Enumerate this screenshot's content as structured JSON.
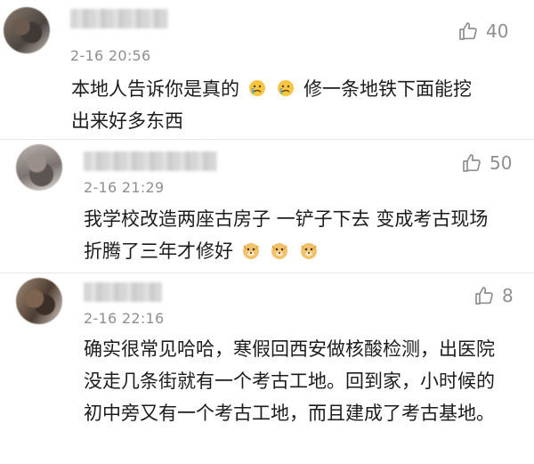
{
  "comments": [
    {
      "timestamp": "2-16 20:56",
      "likes": "40",
      "text_before_emoji": "本地人告诉你是真的",
      "emoji": [
        "crying-face",
        "crying-face"
      ],
      "text_after_emoji": "修一条地铁下面能挖出来好多东西"
    },
    {
      "timestamp": "2-16 21:29",
      "likes": "50",
      "text_before_emoji": "我学校改造两座古房子 一铲子下去 变成考古现场 折腾了三年才修好",
      "emoji": [
        "doge",
        "doge",
        "doge"
      ],
      "text_after_emoji": ""
    },
    {
      "timestamp": "2-16 22:16",
      "likes": "8",
      "text_before_emoji": "确实很常见哈哈，寒假回西安做核酸检测，出医院没走几条街就有一个考古工地。回到家，小时候的初中旁又有一个考古工地，而且建成了考古基地。",
      "emoji": [],
      "text_after_emoji": ""
    }
  ],
  "colors": {
    "meta": "#8f8f8f",
    "text": "#1c1c1c",
    "divider": "#e6e6e6"
  }
}
